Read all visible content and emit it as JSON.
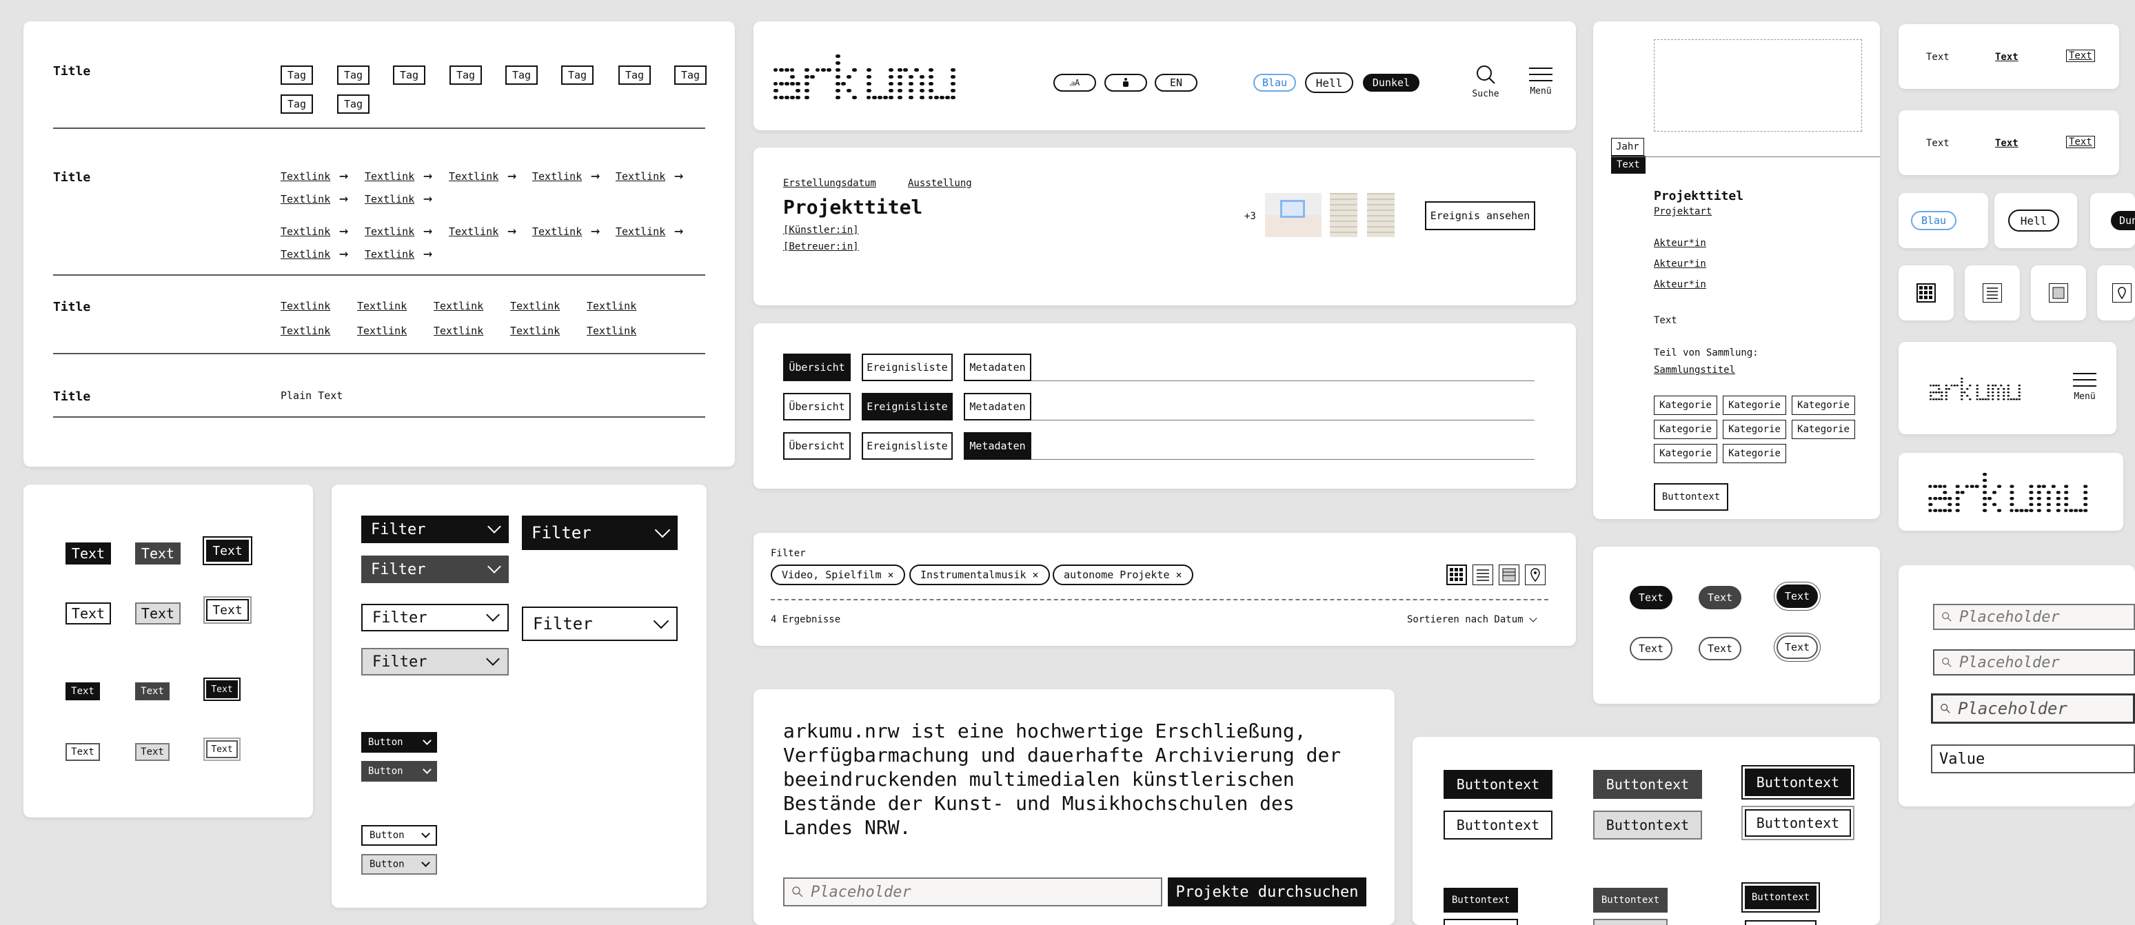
{
  "brand": "arkumu",
  "tags_section": {
    "title": "Title",
    "tags": [
      "Tag",
      "Tag",
      "Tag",
      "Tag",
      "Tag",
      "Tag",
      "Tag",
      "Tag",
      "Tag",
      "Tag"
    ]
  },
  "textlinks_arrow": {
    "title": "Title",
    "rows": [
      [
        "Textlink",
        "Textlink",
        "Textlink",
        "Textlink",
        "Textlink"
      ],
      [
        "Textlink",
        "Textlink"
      ],
      [
        "Textlink",
        "Textlink",
        "Textlink",
        "Textlink",
        "Textlink"
      ],
      [
        "Textlink",
        "Textlink"
      ]
    ]
  },
  "textlinks_grid": {
    "title": "Title",
    "rows": [
      [
        "Textlink",
        "Textlink",
        "Textlink",
        "Textlink",
        "Textlink"
      ],
      [
        "Textlink",
        "Textlink",
        "Textlink",
        "Textlink",
        "Textlink"
      ]
    ]
  },
  "plain": {
    "title": "Title",
    "text": "Plain Text"
  },
  "header": {
    "lang_en": "EN",
    "theme_blue": "Blau",
    "theme_light": "Hell",
    "theme_dark": "Dunkel",
    "search_label": "Suche",
    "menu_label": "Menü"
  },
  "project_card": {
    "meta1": "Erstellungsdatum",
    "meta2": "Ausstellung",
    "title": "Projekttitel",
    "artist": "[Künstler:in]",
    "supervisor": "[Betreuer:in]",
    "more_count": "+3",
    "view_button": "Ereignis ansehen"
  },
  "tabs": {
    "labels": [
      "Übersicht",
      "Ereignisliste",
      "Metadaten"
    ]
  },
  "filter_bar": {
    "label": "Filter",
    "chips": [
      "Video, Spielfilm ×",
      "Instrumentalmusik ×",
      "autonome Projekte ×"
    ],
    "results": "4 Ergebnisse",
    "sort": "Sortieren nach Datum"
  },
  "intro": {
    "text": "arkumu.nrw ist eine hochwertige Erschließung, Verfügbarmachung und dauerhafte Archivierung der beeindruckenden multimedialen künstlerischen Bestände der Kunst- und Musikhochschulen des Landes NRW.",
    "placeholder": "Placeholder",
    "search_button": "Projekte durchsuchen"
  },
  "text_buttons": {
    "label": "Text"
  },
  "filters": {
    "label": "Filter"
  },
  "small_buttons": {
    "label": "Button"
  },
  "sidebar_project": {
    "year": "Jahr",
    "text_tag": "Text",
    "title": "Projekttitel",
    "type": "Projektart",
    "actors": [
      "Akteur*in",
      "Akteur*in",
      "Akteur*in"
    ],
    "text": "Text",
    "collection_label": "Teil von Sammlung:",
    "collection": "Sammlungstitel",
    "categories": [
      "Kategorie",
      "Kategorie",
      "Kategorie",
      "Kategorie",
      "Kategorie",
      "Kategorie",
      "Kategorie",
      "Kategorie"
    ],
    "button": "Buttontext"
  },
  "pills": {
    "label": "Text"
  },
  "big_buttons": {
    "label": "Buttontext"
  },
  "right_col": {
    "text_link": "Text",
    "blue": "Blau",
    "light": "Hell",
    "dark": "Dunkel",
    "menu": "Menü",
    "placeholder": "Placeholder",
    "value": "Value"
  }
}
